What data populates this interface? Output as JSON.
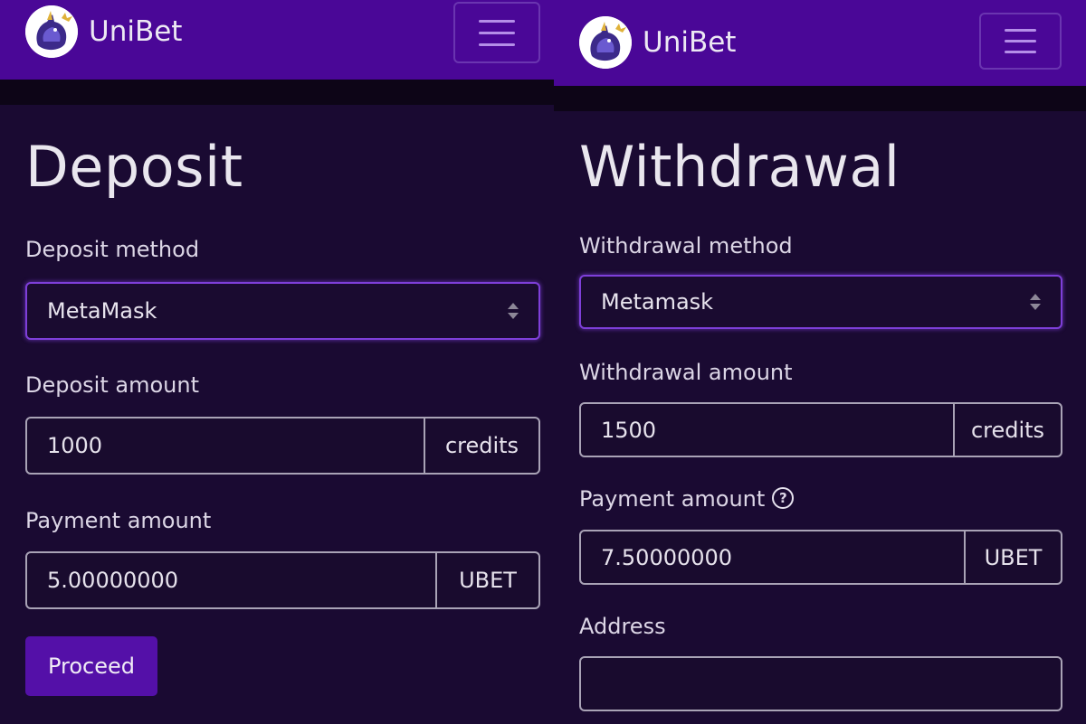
{
  "brand": {
    "name": "UniBet"
  },
  "deposit": {
    "title": "Deposit",
    "method_label": "Deposit method",
    "method_value": "MetaMask",
    "amount_label": "Deposit amount",
    "amount_value": "1000",
    "amount_unit": "credits",
    "payment_label": "Payment amount",
    "payment_value": "5.00000000",
    "payment_unit": "UBET",
    "proceed_label": "Proceed"
  },
  "withdrawal": {
    "title": "Withdrawal",
    "method_label": "Withdrawal method",
    "method_value": "Metamask",
    "amount_label": "Withdrawal amount",
    "amount_value": "1500",
    "amount_unit": "credits",
    "payment_label": "Payment amount",
    "help_glyph": "?",
    "payment_value": "7.50000000",
    "payment_unit": "UBET",
    "address_label": "Address",
    "address_value": ""
  },
  "colors": {
    "navbar": "#4a0797",
    "background": "#1a0a32",
    "accent": "#7e3fd9",
    "button": "#5410a8"
  },
  "icons": {
    "logo": "unicorn-crest-icon",
    "menu": "hamburger-menu-icon",
    "select_caret": "updown-caret-icon",
    "help": "question-circle-icon"
  }
}
